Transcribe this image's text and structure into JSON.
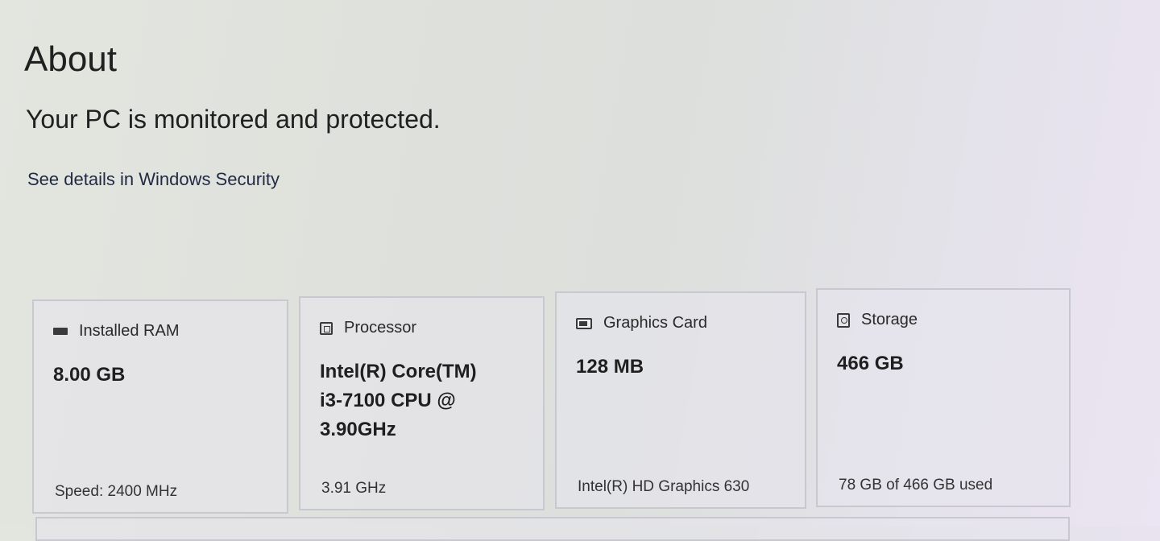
{
  "page": {
    "title": "About",
    "status": "Your PC is monitored and protected.",
    "security_link": "See details in Windows Security"
  },
  "cards": [
    {
      "label": "Installed RAM",
      "icon": "ram-icon",
      "value": "8.00 GB",
      "footer": "Speed: 2400 MHz"
    },
    {
      "label": "Processor",
      "icon": "processor-icon",
      "value": "Intel(R) Core(TM)\ni3-7100 CPU @\n3.90GHz",
      "footer": "3.91 GHz"
    },
    {
      "label": "Graphics Card",
      "icon": "graphics-card-icon",
      "value": "128 MB",
      "footer": "Intel(R) HD Graphics 630"
    },
    {
      "label": "Storage",
      "icon": "storage-icon",
      "value": "466 GB",
      "footer": "78 GB of 466 GB used"
    }
  ],
  "colors": {
    "link": "#1f2a44",
    "text": "#1f1f1f",
    "card_border": "#c9c7cf"
  }
}
